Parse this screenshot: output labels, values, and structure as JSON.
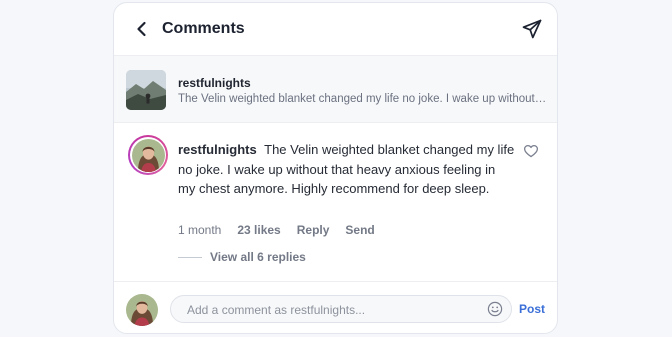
{
  "header": {
    "title": "Comments"
  },
  "post": {
    "username": "restfulnights",
    "snippet": "The Velin weighted blanket changed my life no joke. I wake up without that heavy anxious feeling in my chest anymore. Highly recommend for deep sleep."
  },
  "comment": {
    "username": "restfulnights",
    "text": "The Velin weighted blanket changed my life no joke. I wake up without that heavy anxious feeling in my chest anymore. Highly recommend for deep sleep.",
    "age": "1 month",
    "likes": "23 likes",
    "reply_label": "Reply",
    "send_label": "Send",
    "view_replies_label": "View all 6 replies"
  },
  "composer": {
    "placeholder": "Add a comment as restfulnights...",
    "post_label": "Post"
  },
  "icons": {
    "back": "chevron-left-icon",
    "send": "paper-plane-icon",
    "like": "heart-outline-icon",
    "emoji": "smiley-icon"
  },
  "colors": {
    "accent": "#3b6fd8",
    "story_ring": "#c9389a"
  }
}
